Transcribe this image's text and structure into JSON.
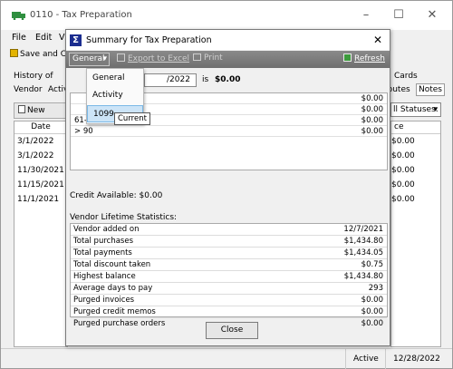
{
  "main": {
    "title": "0110 - Tax Preparation",
    "menus": [
      "File",
      "Edit",
      "V"
    ],
    "save_label": "Save and C",
    "tabs_left": "History of",
    "cards_label": "Cards",
    "subtabs": {
      "vendor": "Vendor",
      "active": "Activ",
      "butes": "ibutes",
      "notes": "Notes"
    },
    "new_invoice": "New Invoi",
    "status_filter": "ll Statuses:",
    "left_grid": {
      "header": "Date",
      "rows": [
        "3/1/2022",
        "3/1/2022",
        "11/30/2021",
        "11/15/2021",
        "11/1/2021"
      ]
    },
    "right_grid": {
      "header": "ce",
      "rows": [
        "$0.00",
        "$0.00",
        "$0.00",
        "$0.00",
        "$0.00"
      ]
    },
    "status": {
      "state": "Active",
      "date": "12/28/2022"
    }
  },
  "dialog": {
    "title": "Summary for Tax Preparation",
    "toolbar": {
      "general": "General",
      "export": "Export to Excel",
      "print": "Print",
      "refresh": "Refresh"
    },
    "date_value": "/2022",
    "is_label": "is",
    "amount": "$0.00",
    "aging": [
      {
        "label": "",
        "value": "$0.00"
      },
      {
        "label": "",
        "value": "$0.00"
      },
      {
        "label": "61-90",
        "value": "$0.00"
      },
      {
        "label": "> 90",
        "value": "$0.00"
      }
    ],
    "credit_available": "Credit Available:  $0.00",
    "lifetime_label": "Vendor Lifetime Statistics:",
    "lifetime": [
      {
        "label": "Vendor added on",
        "value": "12/7/2021"
      },
      {
        "label": "Total purchases",
        "value": "$1,434.80"
      },
      {
        "label": "Total payments",
        "value": "$1,434.05"
      },
      {
        "label": "Total discount taken",
        "value": "$0.75"
      },
      {
        "label": "Highest balance",
        "value": "$1,434.80"
      },
      {
        "label": "Average days to pay",
        "value": "293"
      },
      {
        "label": "Purged invoices",
        "value": "$0.00"
      },
      {
        "label": "Purged credit memos",
        "value": "$0.00"
      },
      {
        "label": "Purged purchase orders",
        "value": "$0.00"
      }
    ],
    "close_label": "Close"
  },
  "dropdown": {
    "options": [
      "General",
      "Activity",
      "1099"
    ],
    "selected": "1099",
    "tooltip": "Current"
  },
  "colors": {
    "toolbar": "#7c7c7c",
    "selection": "#cce4f7",
    "truck": "#2f8f3f",
    "sigma": "#1b2d8f"
  }
}
